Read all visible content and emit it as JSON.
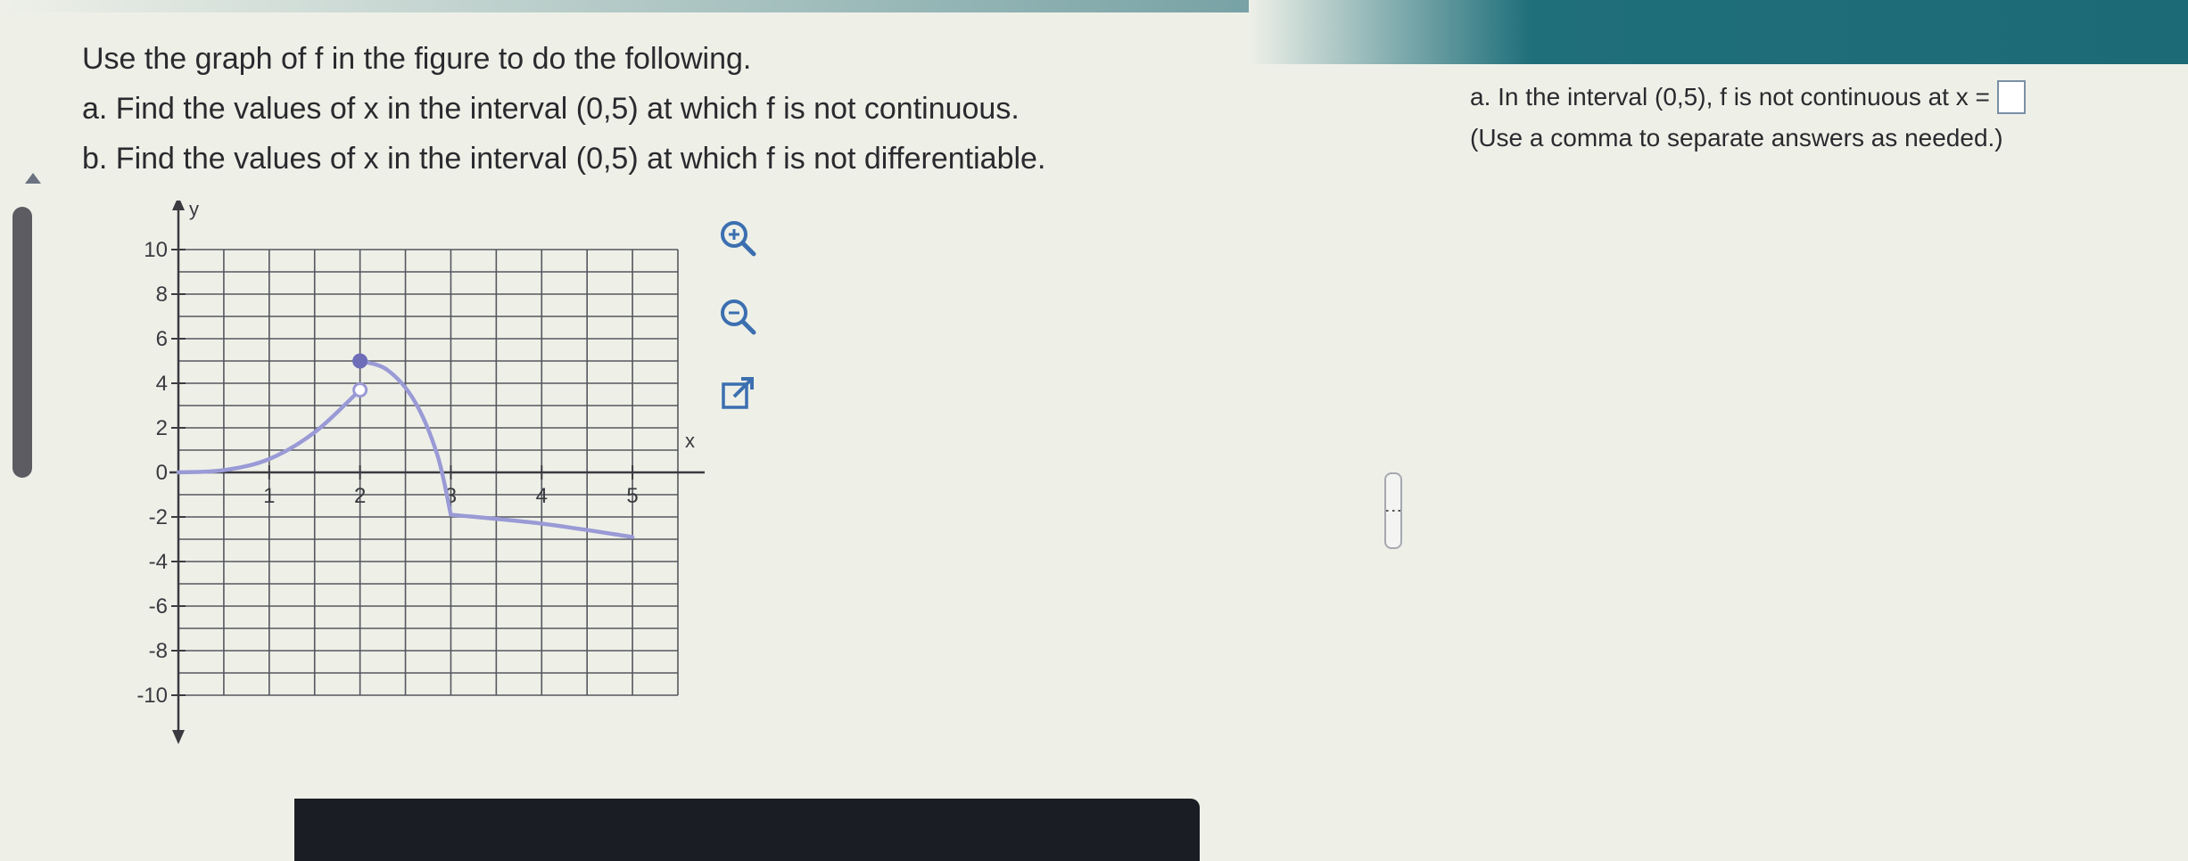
{
  "instructions": {
    "line1": "Use the graph of f in the figure to do the following.",
    "line2": "a. Find the values of x in the interval (0,5) at which f is not continuous.",
    "line3": "b. Find the values of x in the interval (0,5) at which f is not differentiable."
  },
  "answer_panel": {
    "prompt_a": "a. In the interval (0,5), f is not continuous at x =",
    "hint": "(Use a comma to separate answers as needed.)",
    "answer_value": ""
  },
  "tools": {
    "zoom_in": "zoom-in-icon",
    "zoom_out": "zoom-out-icon",
    "popout": "external-link-icon"
  },
  "chart_data": {
    "type": "line",
    "xlabel": "x",
    "ylabel": "y",
    "xlim": [
      0,
      5
    ],
    "ylim": [
      -10,
      10
    ],
    "x_ticks": [
      1,
      2,
      3,
      4,
      5
    ],
    "x_tick_labels": [
      "1",
      "2",
      "3",
      "4",
      "5"
    ],
    "y_ticks": [
      10,
      8,
      6,
      4,
      2,
      0,
      -2,
      -4,
      -6,
      -8,
      -10
    ],
    "y_tick_labels": [
      "10",
      "8",
      "6",
      "4",
      "2",
      "0",
      "-2",
      "-4",
      "-6",
      "-8",
      "-10"
    ],
    "grid": true,
    "series": [
      {
        "points": [
          [
            0,
            0
          ],
          [
            0.5,
            0.1
          ],
          [
            1,
            0.6
          ],
          [
            1.5,
            1.8
          ],
          [
            2,
            3.7
          ]
        ],
        "end_marker": "open"
      },
      {
        "points": [
          [
            2,
            5
          ],
          [
            2.3,
            4.6
          ],
          [
            2.6,
            3.2
          ],
          [
            2.85,
            0.8
          ],
          [
            3,
            -1.9
          ]
        ],
        "start_marker": "closed"
      },
      {
        "points": [
          [
            3,
            -1.9
          ],
          [
            4,
            -2.3
          ],
          [
            5,
            -2.9
          ]
        ]
      }
    ],
    "colors": {
      "curve": "#9a9ad6",
      "grid": "#55575e",
      "axis": "#3a3a40"
    }
  }
}
